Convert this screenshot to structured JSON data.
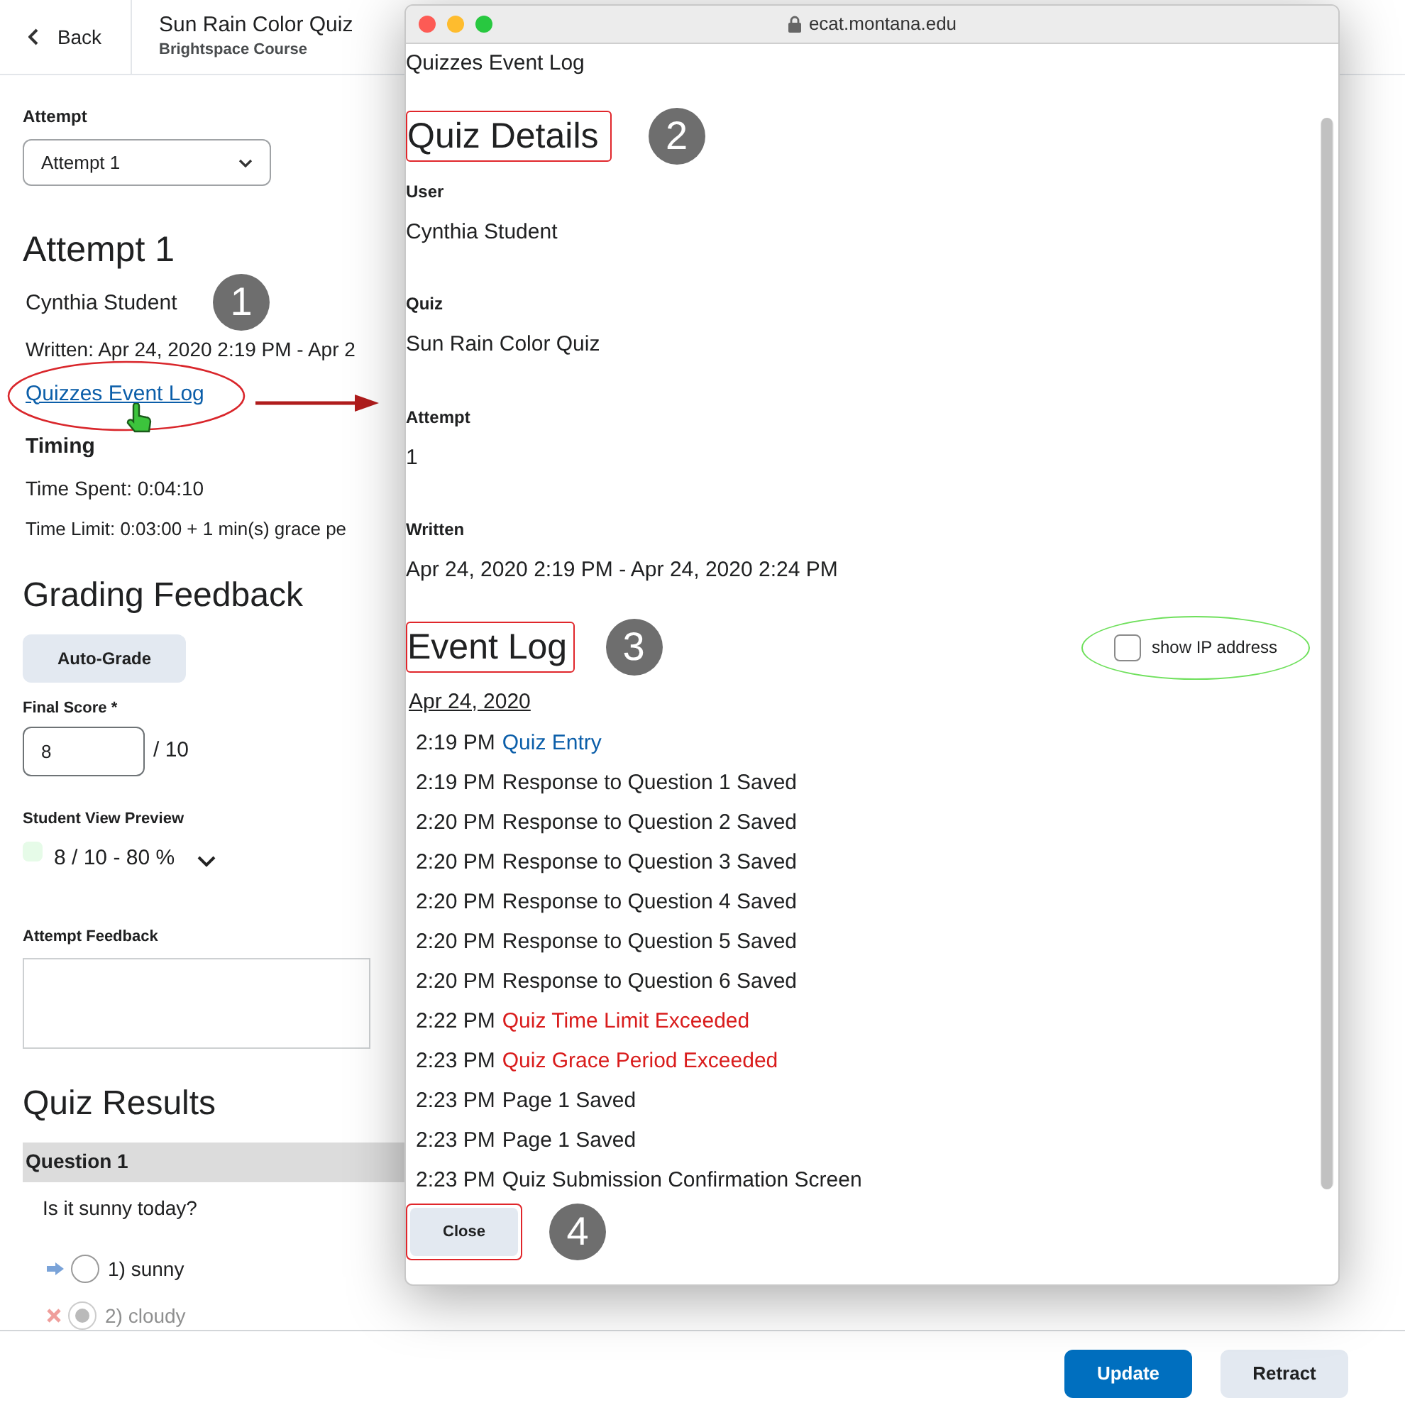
{
  "header": {
    "back_label": "Back",
    "title": "Sun Rain Color Quiz",
    "subtitle": "Brightspace Course"
  },
  "attempt": {
    "label": "Attempt",
    "select_value": "Attempt 1",
    "heading": "Attempt 1",
    "student": "Cynthia Student",
    "written": "Written: Apr 24, 2020 2:19 PM - Apr 2",
    "event_log_link": "Quizzes Event Log",
    "timing_heading": "Timing",
    "time_spent": "Time Spent: 0:04:10",
    "time_limit": "Time Limit: 0:03:00 + 1 min(s) grace pe"
  },
  "grading": {
    "heading": "Grading Feedback",
    "auto_grade": "Auto-Grade",
    "final_score_label": "Final Score *",
    "score": "8",
    "out_of": "/ 10",
    "preview_label": "Student View Preview",
    "preview": "8 / 10 - 80 %",
    "feedback_label": "Attempt Feedback"
  },
  "results": {
    "heading": "Quiz Results",
    "question": "Question 1",
    "prompt": "Is it sunny today?",
    "options": [
      {
        "label": "1) sunny",
        "kind": "correct",
        "selected": false
      },
      {
        "label": "2) cloudy",
        "kind": "incorrect",
        "selected": true
      }
    ]
  },
  "footer": {
    "buttons": [
      {
        "label": "Update",
        "kind": "primary"
      },
      {
        "label": "Retract",
        "kind": "secondary"
      }
    ]
  },
  "popup": {
    "url": "ecat.montana.edu",
    "page_title": "Quizzes Event Log",
    "details_heading": "Quiz Details",
    "fields": [
      {
        "label": "User",
        "value": "Cynthia Student"
      },
      {
        "label": "Quiz",
        "value": "Sun Rain Color Quiz"
      },
      {
        "label": "Attempt",
        "value": "1"
      },
      {
        "label": "Written",
        "value": "Apr 24, 2020 2:19 PM - Apr 24, 2020 2:24 PM"
      }
    ],
    "log_heading": "Event Log",
    "show_ip": {
      "label": "show IP address",
      "checked": false
    },
    "date": "Apr 24, 2020",
    "events": [
      {
        "time": "2:19 PM",
        "text": "Quiz Entry",
        "kind": "link"
      },
      {
        "time": "2:19 PM",
        "text": "Response to Question 1 Saved",
        "kind": "plain"
      },
      {
        "time": "2:20 PM",
        "text": "Response to Question 2 Saved",
        "kind": "plain"
      },
      {
        "time": "2:20 PM",
        "text": "Response to Question 3 Saved",
        "kind": "plain"
      },
      {
        "time": "2:20 PM",
        "text": "Response to Question 4 Saved",
        "kind": "plain"
      },
      {
        "time": "2:20 PM",
        "text": "Response to Question 5 Saved",
        "kind": "plain"
      },
      {
        "time": "2:20 PM",
        "text": "Response to Question 6 Saved",
        "kind": "plain"
      },
      {
        "time": "2:22 PM",
        "text": "Quiz Time Limit Exceeded",
        "kind": "alert"
      },
      {
        "time": "2:23 PM",
        "text": "Quiz Grace Period Exceeded",
        "kind": "alert"
      },
      {
        "time": "2:23 PM",
        "text": "Page 1 Saved",
        "kind": "plain"
      },
      {
        "time": "2:23 PM",
        "text": "Page 1 Saved",
        "kind": "plain"
      },
      {
        "time": "2:23 PM",
        "text": "Quiz Submission Confirmation Screen",
        "kind": "plain"
      }
    ],
    "close": "Close"
  },
  "callouts": [
    "1",
    "2",
    "3",
    "4"
  ]
}
